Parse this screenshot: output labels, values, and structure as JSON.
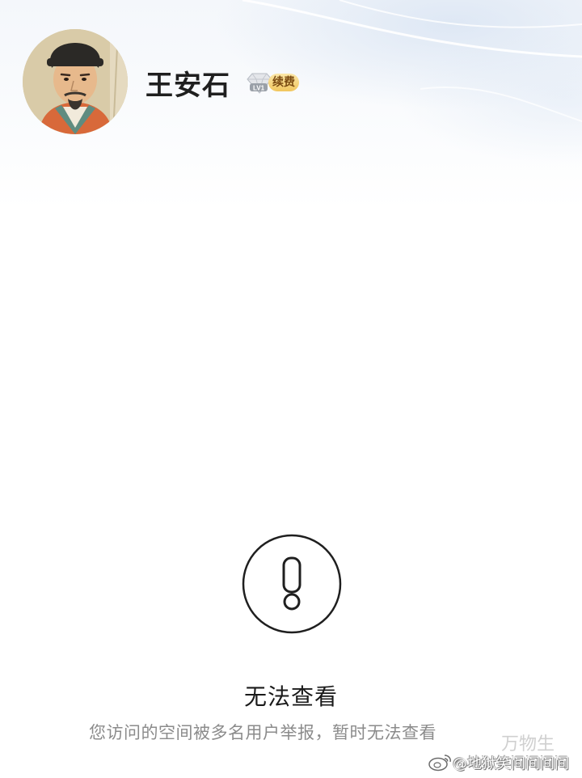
{
  "profile": {
    "username": "王安石",
    "vip_level": "LV1",
    "vip_action": "续费",
    "avatar_alt": "avatar"
  },
  "notice": {
    "icon": "exclamation-circle-icon",
    "title": "无法查看",
    "description": "您访问的空间被多名用户举报，暂时无法查看"
  },
  "watermark": {
    "small": "万物生",
    "handle": "@地狱笑间间间间",
    "logo_icon": "weibo-icon"
  },
  "colors": {
    "title": "#1a1a1a",
    "description": "#8b8b8b",
    "vip_gold": "#f1c65e"
  }
}
